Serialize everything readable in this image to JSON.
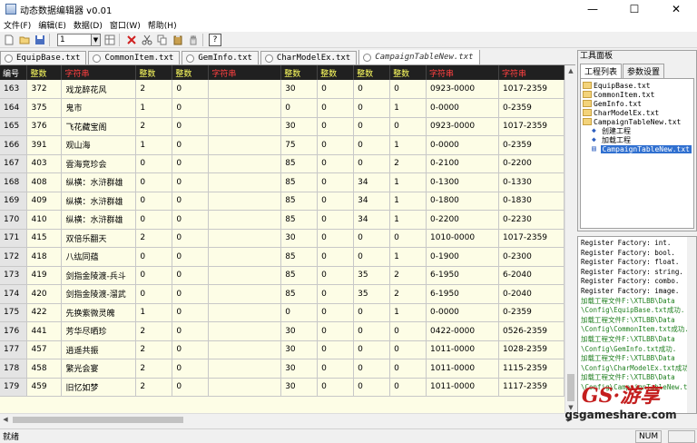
{
  "window": {
    "title": "动态数据编辑器 v0.01",
    "minimize": "—",
    "maximize": "☐",
    "close": "✕"
  },
  "menu": [
    "文件(F)",
    "编辑(E)",
    "数据(D)",
    "窗口(W)",
    "帮助(H)"
  ],
  "toolbar": {
    "page_value": "1",
    "dropdown": "▼",
    "help": "?"
  },
  "tabs": [
    {
      "label": "EquipBase.txt",
      "active": false
    },
    {
      "label": "CommonItem.txt",
      "active": false
    },
    {
      "label": "GemInfo.txt",
      "active": false
    },
    {
      "label": "CharModelEx.txt",
      "active": false
    },
    {
      "label": "CampaignTableNew.txt",
      "active": true
    }
  ],
  "table": {
    "headers": [
      {
        "label": "编号",
        "kind": "idx"
      },
      {
        "label": "整数",
        "kind": "num"
      },
      {
        "label": "字符串",
        "kind": "str"
      },
      {
        "label": "整数",
        "kind": "num"
      },
      {
        "label": "整数",
        "kind": "num"
      },
      {
        "label": "字符串",
        "kind": "str"
      },
      {
        "label": "整数",
        "kind": "num"
      },
      {
        "label": "整数",
        "kind": "num"
      },
      {
        "label": "整数",
        "kind": "num"
      },
      {
        "label": "整数",
        "kind": "num"
      },
      {
        "label": "字符串",
        "kind": "str"
      },
      {
        "label": "字符串",
        "kind": "str"
      }
    ],
    "rows": [
      [
        "163",
        "372",
        "戏龙醉花风",
        "2",
        "0",
        "",
        "30",
        "0",
        "0",
        "0",
        "0923-0000",
        "1017-2359"
      ],
      [
        "164",
        "375",
        "鬼市",
        "1",
        "0",
        "",
        "0",
        "0",
        "0",
        "1",
        "0-0000",
        "0-2359"
      ],
      [
        "165",
        "376",
        "飞花藏宝阁",
        "2",
        "0",
        "",
        "30",
        "0",
        "0",
        "0",
        "0923-0000",
        "1017-2359"
      ],
      [
        "166",
        "391",
        "观山海",
        "1",
        "0",
        "",
        "75",
        "0",
        "0",
        "1",
        "0-0000",
        "0-2359"
      ],
      [
        "167",
        "403",
        "雲海竞珍会",
        "0",
        "0",
        "",
        "85",
        "0",
        "0",
        "2",
        "0-2100",
        "0-2200"
      ],
      [
        "168",
        "408",
        "纵横：水浒群雄",
        "0",
        "0",
        "",
        "85",
        "0",
        "34",
        "1",
        "0-1300",
        "0-1330"
      ],
      [
        "169",
        "409",
        "纵横：水浒群雄",
        "0",
        "0",
        "",
        "85",
        "0",
        "34",
        "1",
        "0-1800",
        "0-1830"
      ],
      [
        "170",
        "410",
        "纵横：水浒群雄",
        "0",
        "0",
        "",
        "85",
        "0",
        "34",
        "1",
        "0-2200",
        "0-2230"
      ],
      [
        "171",
        "415",
        "双倍乐翻天",
        "2",
        "0",
        "",
        "30",
        "0",
        "0",
        "0",
        "1010-0000",
        "1017-2359"
      ],
      [
        "172",
        "418",
        "八纮同蕴",
        "0",
        "0",
        "",
        "85",
        "0",
        "0",
        "1",
        "0-1900",
        "0-2300"
      ],
      [
        "173",
        "419",
        "剑指金陵渡-兵斗",
        "0",
        "0",
        "",
        "85",
        "0",
        "35",
        "2",
        "6-1950",
        "6-2040"
      ],
      [
        "174",
        "420",
        "剑指金陵渡-溜武",
        "0",
        "0",
        "",
        "85",
        "0",
        "35",
        "2",
        "6-1950",
        "0-2040"
      ],
      [
        "175",
        "422",
        "先换紫微灵魄",
        "1",
        "0",
        "",
        "0",
        "0",
        "0",
        "1",
        "0-0000",
        "0-2359"
      ],
      [
        "176",
        "441",
        "芳华尽晒珍",
        "2",
        "0",
        "",
        "30",
        "0",
        "0",
        "0",
        "0422-0000",
        "0526-2359"
      ],
      [
        "177",
        "457",
        "逍遥共振",
        "2",
        "0",
        "",
        "30",
        "0",
        "0",
        "0",
        "1011-0000",
        "1028-2359"
      ],
      [
        "178",
        "458",
        "繁光会宴",
        "2",
        "0",
        "",
        "30",
        "0",
        "0",
        "0",
        "1011-0000",
        "1115-2359"
      ],
      [
        "179",
        "459",
        "旧忆如梦",
        "2",
        "0",
        "",
        "30",
        "0",
        "0",
        "0",
        "1011-0000",
        "1117-2359"
      ]
    ]
  },
  "panel": {
    "title": "工具面板",
    "tabs": [
      "工程列表",
      "参数设置"
    ],
    "tree": [
      {
        "label": "EquipBase.txt",
        "type": "folder",
        "depth": 0
      },
      {
        "label": "CommonItem.txt",
        "type": "folder",
        "depth": 0
      },
      {
        "label": "GemInfo.txt",
        "type": "folder",
        "depth": 0
      },
      {
        "label": "CharModelEx.txt",
        "type": "folder",
        "depth": 0
      },
      {
        "label": "CampaignTableNew.txt",
        "type": "folder",
        "depth": 0
      },
      {
        "label": "创建工程",
        "type": "action",
        "depth": 1
      },
      {
        "label": "加载工程",
        "type": "action",
        "depth": 1
      },
      {
        "label": "CampaignTableNew.txt",
        "type": "file",
        "depth": 1,
        "selected": true
      }
    ]
  },
  "log": [
    {
      "text": "Register Factory: int.",
      "green": false
    },
    {
      "text": "Register Factory: bool.",
      "green": false
    },
    {
      "text": "Register Factory: float.",
      "green": false
    },
    {
      "text": "Register Factory: string.",
      "green": false
    },
    {
      "text": "Register Factory: combo.",
      "green": false
    },
    {
      "text": "Register Factory: image.",
      "green": false
    },
    {
      "text": "加载工程文件F:\\XTLBB\\Data",
      "green": true
    },
    {
      "text": "\\Config\\EquipBase.txt成功.",
      "green": true
    },
    {
      "text": "加载工程文件F:\\XTLBB\\Data",
      "green": true
    },
    {
      "text": "\\Config\\CommonItem.txt成功.",
      "green": true
    },
    {
      "text": "加载工程文件F:\\XTLBB\\Data",
      "green": true
    },
    {
      "text": "\\Config\\GemInfo.txt成功.",
      "green": true
    },
    {
      "text": "加载工程文件F:\\XTLBB\\Data",
      "green": true
    },
    {
      "text": "\\Config\\CharModelEx.txt成功.",
      "green": true
    },
    {
      "text": "加载工程文件F:\\XTLBB\\Data",
      "green": true
    },
    {
      "text": "\\Config\\CampaignTableNew.txt成",
      "green": true
    }
  ],
  "status": {
    "text": "就绪",
    "num": "NUM"
  },
  "watermark": {
    "logo": "GS·游享",
    "site": "gsgameshare.com"
  }
}
